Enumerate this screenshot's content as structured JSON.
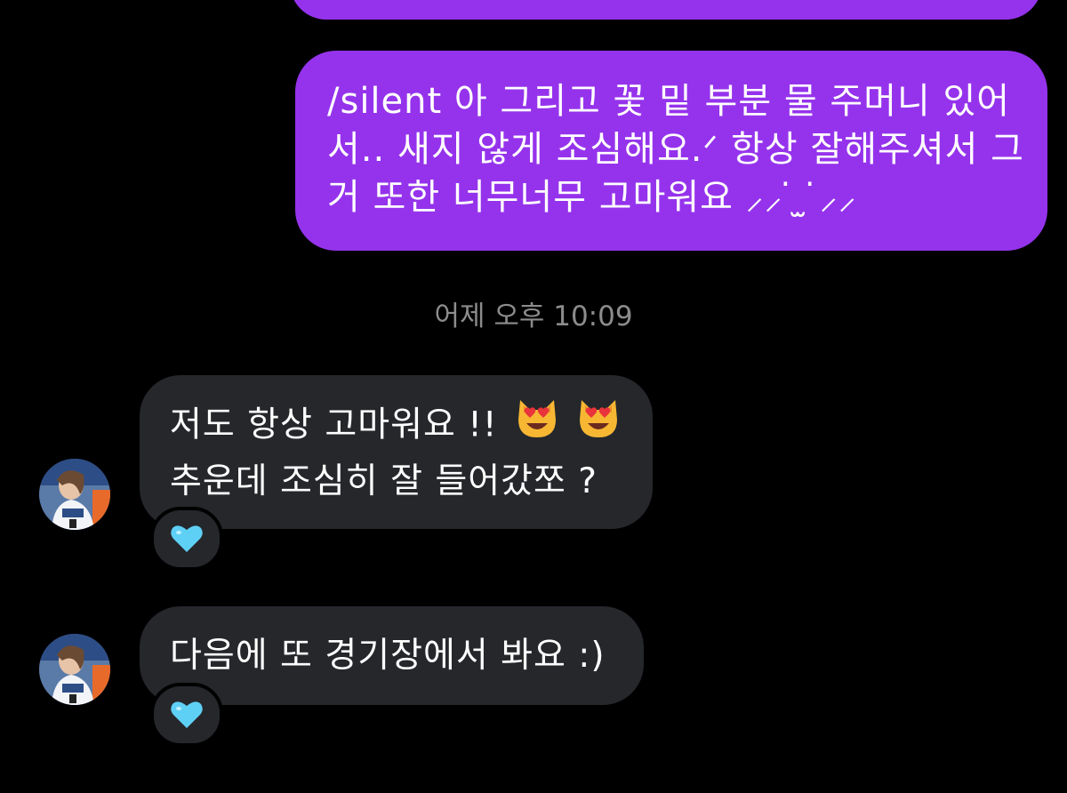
{
  "colors": {
    "background": "#000000",
    "outgoing_bubble": "#9533EC",
    "incoming_bubble": "#25272B",
    "timestamp_text": "#8C8C8C",
    "heart": "#5FD0F5"
  },
  "outgoing": [
    {
      "lines": []
    },
    {
      "lines": [
        "/silent 아 그리고 꽃 밑 부분 물 주머니 있어",
        "서.. 새지 않게 조심해요.ᐟ 항상 잘해주셔서 그",
        "거 또한 너무너무 고마워요  ⸝⸝ ̇ ̫ ̇⸝⸝"
      ]
    }
  ],
  "timestamp": "어제 오후 10:09",
  "incoming": [
    {
      "lines": [
        "저도 항상 고마워요 !!",
        "추운데 조심히 잘 들어갔쪼 ?"
      ],
      "emojis": [
        "heart-eyes-cat",
        "heart-eyes-cat"
      ],
      "reaction": "light-blue-heart"
    },
    {
      "lines": [
        "다음에 또 경기장에서 봐요 :)"
      ],
      "reaction": "light-blue-heart"
    }
  ]
}
